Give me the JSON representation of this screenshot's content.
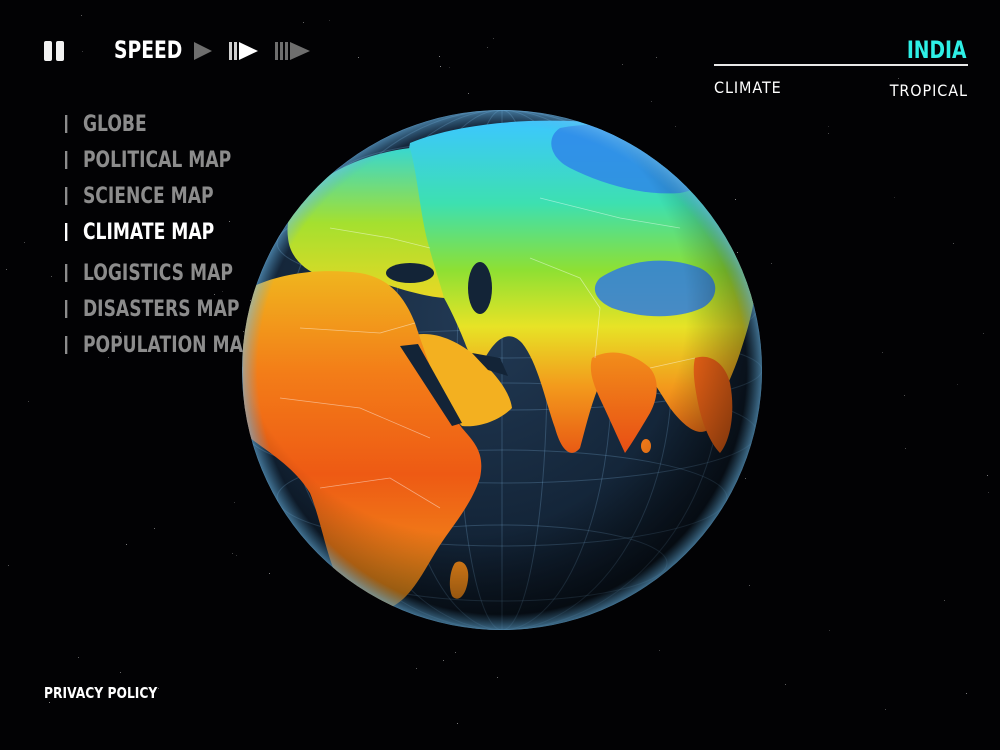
{
  "controls": {
    "speed_label": "SPEED",
    "pause_icon": "pause-icon",
    "speed_icons": [
      "play-slow-icon",
      "play-normal-icon",
      "fast-forward-icon"
    ]
  },
  "menu": {
    "items": [
      {
        "label": "GLOBE",
        "active": false
      },
      {
        "label": "POLITICAL MAP",
        "active": false
      },
      {
        "label": "SCIENCE MAP",
        "active": false
      },
      {
        "label": "CLIMATE MAP",
        "active": true
      },
      {
        "label": "LOGISTICS MAP",
        "active": false
      },
      {
        "label": "DISASTERS MAP",
        "active": false
      },
      {
        "label": "POPULATION MAP",
        "active": false
      }
    ]
  },
  "info": {
    "country": "INDIA",
    "attribute_label": "CLIMATE",
    "attribute_value": "TROPICAL",
    "accent_color": "#2ef0e6"
  },
  "footer": {
    "privacy_label": "PRIVACY POLICY"
  }
}
